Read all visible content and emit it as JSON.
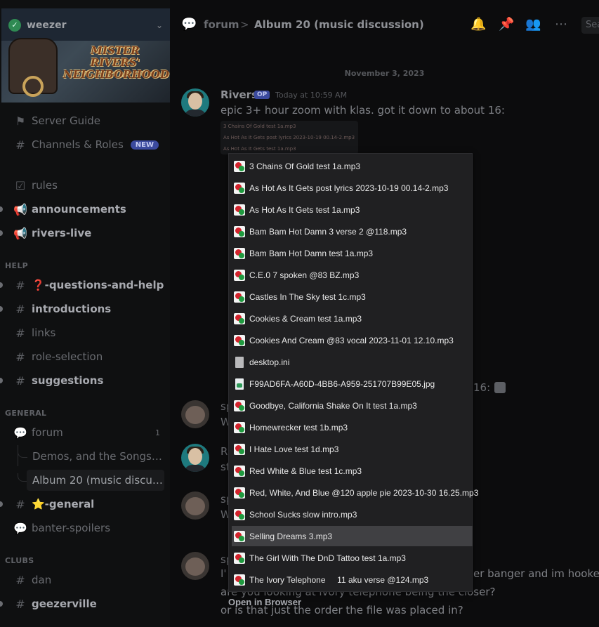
{
  "server": {
    "name": "weezer",
    "banner_text": [
      "MISTER",
      "RIVERS'",
      "NEIGHBORHOOD"
    ]
  },
  "sidebar": {
    "top_items": [
      {
        "label": "Server Guide",
        "icon": "signpost-icon"
      },
      {
        "label": "Channels & Roles",
        "icon": "hash-icon",
        "badge": "NEW"
      }
    ],
    "channels_a": [
      {
        "label": "rules",
        "icon": "checklist-icon"
      },
      {
        "label": "announcements",
        "icon": "megaphone-icon"
      },
      {
        "label": "rivers-live",
        "icon": "megaphone-icon"
      }
    ],
    "category_help": "HELP",
    "help_channels": [
      {
        "label": "❓-questions-and-help"
      },
      {
        "label": "introductions"
      },
      {
        "label": "links"
      },
      {
        "label": "role-selection"
      },
      {
        "label": "suggestions"
      }
    ],
    "category_general": "GENERAL",
    "forum": {
      "label": "forum",
      "count": "1"
    },
    "threads": [
      "Demos, and the Songs t...",
      "Album 20 (music discus..."
    ],
    "general_channels": [
      {
        "label": "⭐-general"
      },
      {
        "label": "banter-spoilers"
      }
    ],
    "category_clubs": "CLUBS",
    "clubs_channels": [
      {
        "label": "dan"
      },
      {
        "label": "geezerville"
      }
    ]
  },
  "header": {
    "crumb": "forum",
    "separator": ">",
    "title": "Album 20 (music discussion)",
    "search_placeholder": "Sea"
  },
  "chat": {
    "date_divider": "November 3, 2023",
    "first_message": {
      "author": "Rivers",
      "tag": "OP",
      "timestamp": "Today at 10:59 AM",
      "text": "epic 3+ hour zoom with klas. got it down to about 16:"
    },
    "screenshot_lines": [
      "3 Chains Of Gold test 1a.mp3",
      "As Hot As It Gets post lyrics 2023-10-19 00.14-2.mp3",
      "As Hot As It Gets test 1a.mp3"
    ],
    "fragments": {
      "f1": "16:",
      "f2": "sp",
      "f3": "W",
      "f4": "R",
      "f5": "st",
      "f6": "sp",
      "f7": "W",
      "f8": "sp",
      "f9": "I'",
      "f10": "er banger and im hooked.",
      "f11": "are you looking at ivory telephone being the closer?",
      "f12": "or is that just the order the file was placed in?"
    }
  },
  "menu": {
    "items": [
      {
        "label": "3 Chains Of Gold test 1a.mp3",
        "type": "mp3"
      },
      {
        "label": "As Hot As It Gets post lyrics 2023-10-19 00.14-2.mp3",
        "type": "mp3"
      },
      {
        "label": "As Hot As It Gets test 1a.mp3",
        "type": "mp3"
      },
      {
        "label": "Bam Bam Hot Damn 3 verse 2 @118.mp3",
        "type": "mp3"
      },
      {
        "label": "Bam Bam Hot Damn test 1a.mp3",
        "type": "mp3"
      },
      {
        "label": "C.E.0 7 spoken @83 BZ.mp3",
        "type": "mp3"
      },
      {
        "label": "Castles In The Sky test 1c.mp3",
        "type": "mp3"
      },
      {
        "label": "Cookies & Cream test 1a.mp3",
        "type": "mp3"
      },
      {
        "label": "Cookies And Cream @83 vocal 2023-11-01 12.10.mp3",
        "type": "mp3"
      },
      {
        "label": "desktop.ini",
        "type": "ini"
      },
      {
        "label": "F99AD6FA-A60D-4BB6-A959-251707B99E05.jpg",
        "type": "jpg"
      },
      {
        "label": "Goodbye, California Shake On It test 1a.mp3",
        "type": "mp3"
      },
      {
        "label": "Homewrecker test 1b.mp3",
        "type": "mp3"
      },
      {
        "label": "I Hate Love test 1d.mp3",
        "type": "mp3"
      },
      {
        "label": "Red White & Blue test 1c.mp3",
        "type": "mp3"
      },
      {
        "label": "Red, White, And Blue @120 apple pie 2023-10-30 16.25.mp3",
        "type": "mp3"
      },
      {
        "label": "School Sucks slow intro.mp3",
        "type": "mp3"
      },
      {
        "label": "Selling Dreams 3.mp3",
        "type": "mp3",
        "hovered": true
      },
      {
        "label": "The Girl With The DnD Tattoo test 1a.mp3",
        "type": "mp3"
      },
      {
        "label": "The Ivory Telephone     11 aku verse @124.mp3",
        "type": "mp3"
      }
    ],
    "open_in_browser": "Open in Browser"
  },
  "colors": {
    "accent": "#3b4a9e",
    "online": "#2f8a53",
    "menu_bg": "#202022",
    "menu_hover": "#404043"
  }
}
